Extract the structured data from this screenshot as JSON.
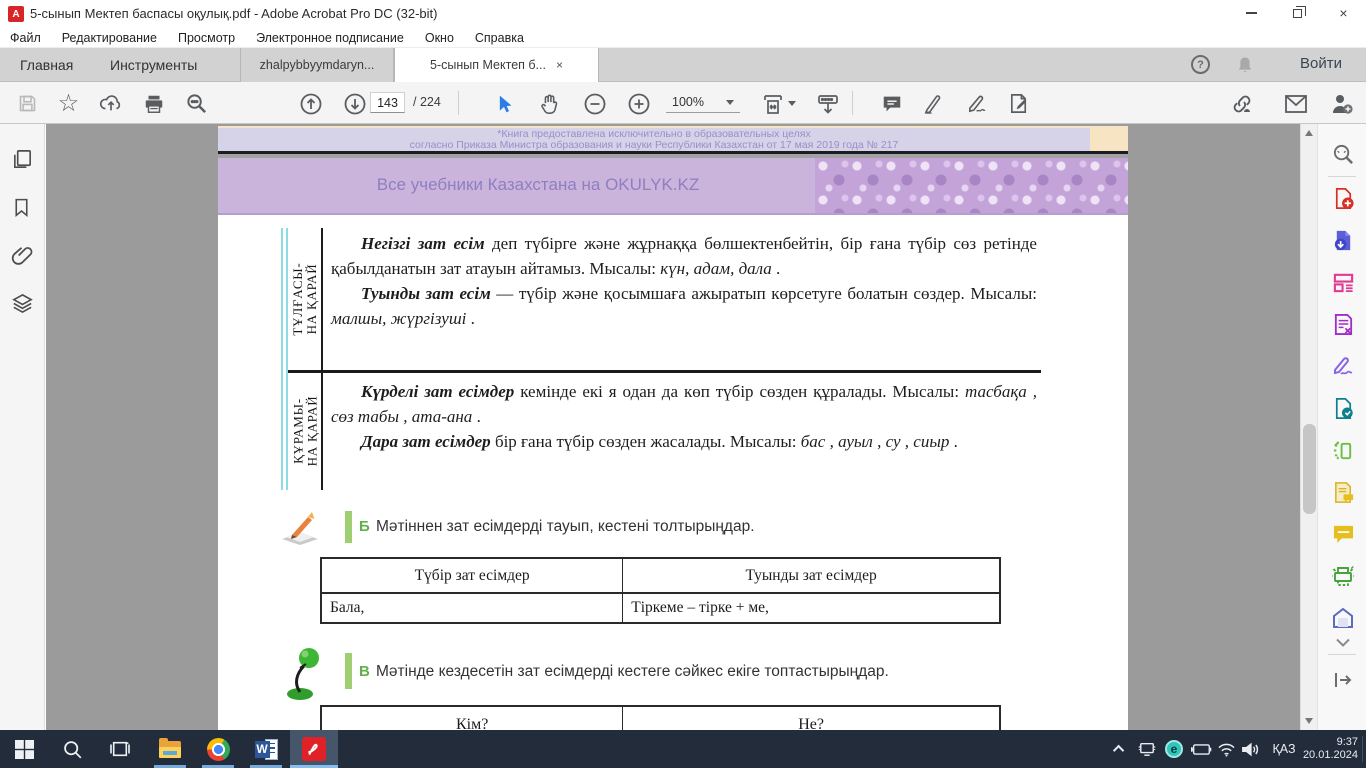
{
  "window": {
    "title": "5-сынып Мектеп баспасы оқулық.pdf - Adobe Acrobat Pro DC (32-bit)",
    "app_initial": "A"
  },
  "menu": [
    "Файл",
    "Редактирование",
    "Просмотр",
    "Электронное подписание",
    "Окно",
    "Справка"
  ],
  "tabbar": {
    "home": "Главная",
    "tools": "Инструменты",
    "doc_tab_1": "zhalpybbyymdaryn...",
    "doc_tab_2": "5-сынып Мектеп б...",
    "tab_close_glyph": "×",
    "help_glyph": "?",
    "sign_in": "Войти"
  },
  "toolbar": {
    "page_current": "143",
    "page_total_label": "/ 224",
    "zoom_label": "100%"
  },
  "pdf": {
    "watermark_line1": "*Книга предоставлена исключительно в образовательных целях",
    "watermark_line2": "согласно Приказа Министра образования и науки Республики Казахстан от 17 мая 2019 года № 217",
    "site_banner": "Все учебники Казахстана на OKULYK.KZ",
    "rule_rows": [
      {
        "label1": "ТҰЛҒАСЫ-",
        "label2": "НА ҚАРАЙ",
        "p1_lead": "Негізгі зат есім",
        "p1_text": " деп түбірге және жұрнаққа бөлшектенбейтін, бір ғана түбір сөз ретінде қабылданатын зат атауын айтамыз. Мысалы: ",
        "p1_examples": "күн, адам, дала",
        "p1_end": " .",
        "p2_lead": "Туынды зат есім",
        "p2_text": " — түбір және қосымшаға ажыратып көрсетуге болатын сөздер. Мысалы: ",
        "p2_examples": "малшы, жүргізуші",
        "p2_end": " ."
      },
      {
        "label1": "ҚҰРАМЫ-",
        "label2": "НА ҚАРАЙ",
        "p1_lead": "Күрделі зат есімдер",
        "p1_text": " кемінде екі я одан да көп түбір сөзден құралады. Мысалы: ",
        "p1_examples": "тасбақа , сөз табы , ата-ана",
        "p1_end": " .",
        "p2_lead": "Дара зат есімдер",
        "p2_text": " бір ғана түбір сөзден жасалады. Мысалы: ",
        "p2_examples": "бас , ауыл , су , сиыр",
        "p2_end": " ."
      }
    ],
    "exercises": [
      {
        "letter": "Б",
        "text": "Мәтіннен зат есімдерді тауып, кестені толтырыңдар."
      },
      {
        "letter": "В",
        "text": "Мәтінде кездесетін зат есімдерді кестеге сәйкес екіге топтастырыңдар."
      }
    ],
    "table_b": {
      "header_left": "Түбір зат есімдер",
      "header_right": "Туынды зат есімдер",
      "cell_left": "Бала,",
      "cell_right": "Тіркеме  –  тірке  +  ме,"
    },
    "table_v": {
      "header_left": "Кім?",
      "header_right": "Не?"
    }
  },
  "taskbar": {
    "language": "ҚАЗ",
    "time": "9:37",
    "date": "20.01.2024",
    "word_letter": "W",
    "eset_letter": "e"
  },
  "colors": {
    "accent_blue": "#2b7de9",
    "taskbar_bg": "#222c3a",
    "exercise_green": "#5fb24a",
    "banner_purple": "#cbb4dc"
  }
}
